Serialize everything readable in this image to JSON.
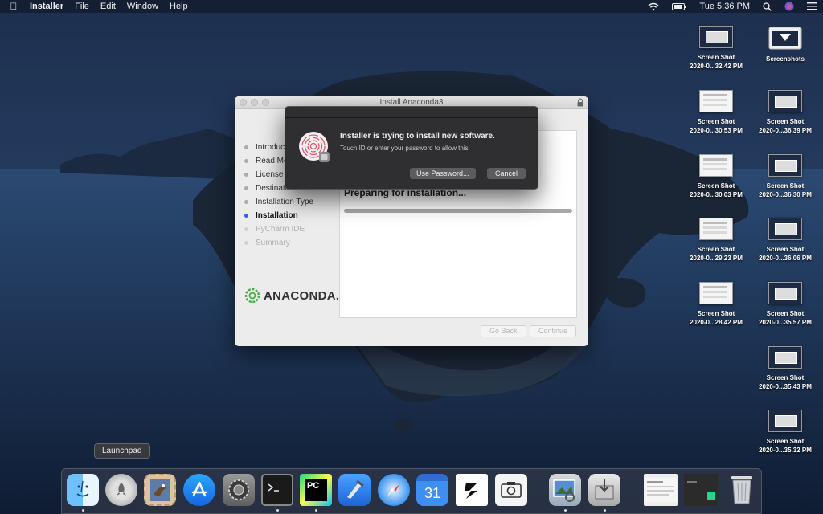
{
  "menubar": {
    "app_name": "Installer",
    "menus": [
      "File",
      "Edit",
      "Window",
      "Help"
    ],
    "clock": "Tue 5:36 PM"
  },
  "installer_window": {
    "title": "Install Anaconda3",
    "steps": [
      "Introduction",
      "Read Me",
      "License",
      "Destination Select",
      "Installation Type",
      "Installation",
      "PyCharm IDE",
      "Summary"
    ],
    "active_step": "Installation",
    "status_text": "Preparing for installation...",
    "progress_fraction": 1.0,
    "logo_text": "ANACONDA.",
    "go_back_label": "Go Back",
    "continue_label": "Continue"
  },
  "auth_dialog": {
    "title": "Installer is trying to install new software.",
    "message": "Touch ID or enter your password to allow this.",
    "use_password_label": "Use Password...",
    "cancel_label": "Cancel"
  },
  "desktop_icons": [
    {
      "line1": "Screen Shot",
      "line2": "2020-0...32.42 PM",
      "style": "dark"
    },
    {
      "line1": "Screenshots",
      "line2": "",
      "style": "folder"
    },
    {
      "line1": "Screen Shot",
      "line2": "2020-0...30.53 PM",
      "style": "light"
    },
    {
      "line1": "Screen Shot",
      "line2": "2020-0...36.39 PM",
      "style": "dark"
    },
    {
      "line1": "Screen Shot",
      "line2": "2020-0...30.03 PM",
      "style": "light"
    },
    {
      "line1": "Screen Shot",
      "line2": "2020-0...36.30 PM",
      "style": "dark"
    },
    {
      "line1": "Screen Shot",
      "line2": "2020-0...29.23 PM",
      "style": "light"
    },
    {
      "line1": "Screen Shot",
      "line2": "2020-0...36.06 PM",
      "style": "dark"
    },
    {
      "line1": "Screen Shot",
      "line2": "2020-0...28.42 PM",
      "style": "light"
    },
    {
      "line1": "Screen Shot",
      "line2": "2020-0...35.57 PM",
      "style": "dark"
    },
    {
      "line1": "Screen Shot",
      "line2": "2020-0...35.43 PM",
      "style": "dark"
    },
    {
      "line1": "Screen Shot",
      "line2": "2020-0...35.32 PM",
      "style": "dark"
    }
  ],
  "tooltip": "Launchpad",
  "dock": {
    "calendar_day": "31",
    "items": [
      "finder-icon",
      "launchpad-icon",
      "mail-icon",
      "app-store-icon",
      "system-preferences-icon",
      "terminal-icon",
      "pycharm-icon",
      "xcode-icon",
      "safari-icon",
      "calendar-icon",
      "app-icon",
      "screenshot-icon",
      "preview-icon",
      "installer-icon",
      "window-thumbnail-icon",
      "window-thumbnail-icon",
      "trash-icon"
    ]
  }
}
